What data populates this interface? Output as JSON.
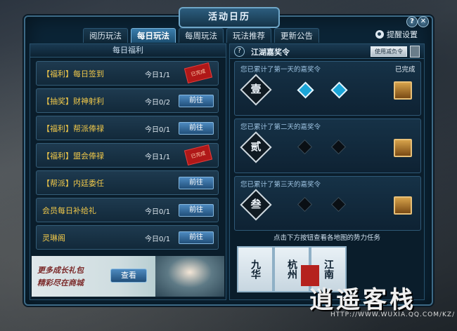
{
  "window": {
    "title": "活动日历",
    "help_icon": "question-icon",
    "close_icon": "close-icon"
  },
  "tabs": [
    {
      "label": "阅历玩法",
      "active": false
    },
    {
      "label": "每日玩法",
      "active": true
    },
    {
      "label": "每周玩法",
      "active": false
    },
    {
      "label": "玩法推荐",
      "active": false
    },
    {
      "label": "更新公告",
      "active": false
    }
  ],
  "remind": {
    "label": "提醒设置"
  },
  "left": {
    "header": "每日福利",
    "rows": [
      {
        "name": "【福利】每日签到",
        "count": "今日1/1",
        "action": "",
        "completed": true
      },
      {
        "name": "【抽奖】财神射利",
        "count": "今日0/2",
        "action": "前往",
        "completed": false
      },
      {
        "name": "【福利】帮派俸禄",
        "count": "今日0/1",
        "action": "前往",
        "completed": false
      },
      {
        "name": "【福利】盟会俸禄",
        "count": "今日1/1",
        "action": "",
        "completed": true
      },
      {
        "name": "【帮派】内廷委任",
        "count": "",
        "action": "前往",
        "completed": false
      },
      {
        "name": "会员每日补给礼",
        "count": "今日0/1",
        "action": "前往",
        "completed": false
      },
      {
        "name": "灵琳阁",
        "count": "今日0/1",
        "action": "前往",
        "completed": false
      }
    ],
    "banner": {
      "line1": "更多成长礼包",
      "line2": "精彩尽在商城",
      "button": "查看"
    }
  },
  "right": {
    "header": "江湖嘉奖令",
    "use_button": "使用减负令",
    "days": [
      {
        "label": "您已累计了第一天的嘉奖令",
        "status": "已完成",
        "numeral": "壹",
        "lit": [
          true,
          true
        ]
      },
      {
        "label": "您已累计了第二天的嘉奖令",
        "status": "",
        "numeral": "贰",
        "lit": [
          false,
          false
        ]
      },
      {
        "label": "您已累计了第三天的嘉奖令",
        "status": "",
        "numeral": "叁",
        "lit": [
          false,
          false
        ]
      }
    ],
    "hint": "点击下方按钮查看各地图的势力任务",
    "maps": [
      "九华",
      "杭州",
      "江南"
    ]
  },
  "watermark": {
    "name": "逍遥客栈",
    "url": "HTTP://WWW.WUXIA.QQ.COM/KZ/"
  },
  "colors": {
    "gold": "#f0c84a",
    "accent": "#1aa5d8",
    "panel": "#0b2436"
  }
}
